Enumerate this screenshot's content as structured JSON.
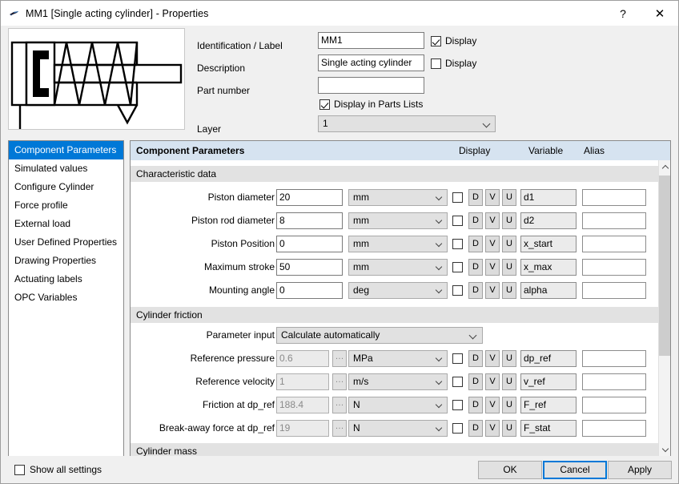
{
  "window": {
    "icon": "cylinder-icon",
    "title": "MM1  [Single acting cylinder] - Properties",
    "help_label": "?",
    "close_label": "✕"
  },
  "header": {
    "preview_alt": "single-acting-cylinder-symbol",
    "identification_label": "Identification / Label",
    "identification_value": "MM1",
    "identification_display_label": "Display",
    "identification_display_checked": true,
    "description_label": "Description",
    "description_value": "Single acting cylinder",
    "description_display_label": "Display",
    "description_display_checked": false,
    "part_number_label": "Part number",
    "part_number_value": "",
    "display_in_parts_lists_label": "Display in Parts Lists",
    "display_in_parts_lists_checked": true,
    "layer_label": "Layer",
    "layer_value": "1"
  },
  "sidebar": {
    "items": [
      {
        "label": "Component Parameters",
        "selected": true
      },
      {
        "label": "Simulated values",
        "selected": false
      },
      {
        "label": "Configure Cylinder",
        "selected": false
      },
      {
        "label": "Force profile",
        "selected": false
      },
      {
        "label": "External load",
        "selected": false
      },
      {
        "label": "User Defined Properties",
        "selected": false
      },
      {
        "label": "Drawing Properties",
        "selected": false
      },
      {
        "label": "Actuating labels",
        "selected": false
      },
      {
        "label": "OPC Variables",
        "selected": false
      }
    ]
  },
  "main": {
    "title": "Component Parameters",
    "columns": {
      "display": "Display",
      "variable": "Variable",
      "alias": "Alias"
    },
    "groups": [
      {
        "name": "Characteristic data",
        "rows": [
          {
            "label": "Piston diameter",
            "value": "20",
            "readonly": false,
            "dots": false,
            "unit": "mm",
            "display_checked": false,
            "d": "D",
            "v": "V",
            "u": "U",
            "variable": "d1",
            "alias": ""
          },
          {
            "label": "Piston rod diameter",
            "value": "8",
            "readonly": false,
            "dots": false,
            "unit": "mm",
            "display_checked": false,
            "d": "D",
            "v": "V",
            "u": "U",
            "variable": "d2",
            "alias": ""
          },
          {
            "label": "Piston Position",
            "value": "0",
            "readonly": false,
            "dots": false,
            "unit": "mm",
            "display_checked": false,
            "d": "D",
            "v": "V",
            "u": "U",
            "variable": "x_start",
            "alias": ""
          },
          {
            "label": "Maximum stroke",
            "value": "50",
            "readonly": false,
            "dots": false,
            "unit": "mm",
            "display_checked": false,
            "d": "D",
            "v": "V",
            "u": "U",
            "variable": "x_max",
            "alias": ""
          },
          {
            "label": "Mounting angle",
            "value": "0",
            "readonly": false,
            "dots": false,
            "unit": "deg",
            "display_checked": false,
            "d": "D",
            "v": "V",
            "u": "U",
            "variable": "alpha",
            "alias": ""
          }
        ]
      },
      {
        "name": "Cylinder friction",
        "parameter_input_label": "Parameter input",
        "parameter_input_value": "Calculate automatically",
        "rows": [
          {
            "label": "Reference pressure",
            "value": "0.6",
            "readonly": true,
            "dots": true,
            "unit": "MPa",
            "display_checked": false,
            "d": "D",
            "v": "V",
            "u": "U",
            "variable": "dp_ref",
            "alias": ""
          },
          {
            "label": "Reference velocity",
            "value": "1",
            "readonly": true,
            "dots": true,
            "unit": "m/s",
            "display_checked": false,
            "d": "D",
            "v": "V",
            "u": "U",
            "variable": "v_ref",
            "alias": ""
          },
          {
            "label": "Friction at dp_ref",
            "value": "188.4",
            "readonly": true,
            "dots": true,
            "unit": "N",
            "display_checked": false,
            "d": "D",
            "v": "V",
            "u": "U",
            "variable": "F_ref",
            "alias": ""
          },
          {
            "label": "Break-away force at dp_ref",
            "value": "19",
            "readonly": true,
            "dots": true,
            "unit": "N",
            "display_checked": false,
            "d": "D",
            "v": "V",
            "u": "U",
            "variable": "F_stat",
            "alias": ""
          }
        ]
      },
      {
        "name": "Cylinder mass",
        "rows": []
      }
    ]
  },
  "footer": {
    "show_all_settings_label": "Show all settings",
    "show_all_settings_checked": false,
    "ok_label": "OK",
    "cancel_label": "Cancel",
    "apply_label": "Apply"
  },
  "colors": {
    "accent": "#0078d7",
    "header_band": "#d6e3f0",
    "group_band": "#e2e2e2",
    "dialog_bg": "#f0f0f0",
    "control_bg": "#e1e1e1"
  }
}
